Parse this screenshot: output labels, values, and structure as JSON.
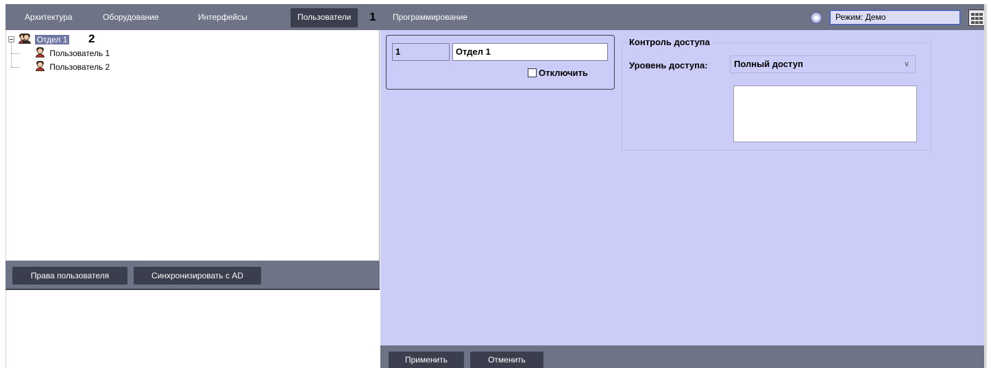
{
  "topbar": {
    "tabs": [
      {
        "label": "Архитектура"
      },
      {
        "label": "Оборудование"
      },
      {
        "label": "Интерфейсы"
      },
      {
        "label": "Пользователи"
      },
      {
        "label": "Программирование"
      }
    ],
    "active_tab": "Пользователи",
    "marker_1": "1",
    "mode_label": "Режим: Демо",
    "colors": {
      "bar": "#6e7386",
      "active": "#3a3e4d"
    }
  },
  "tree": {
    "root": {
      "label": "Отдел 1",
      "icon": "department-icon",
      "expanded": true,
      "selected": true
    },
    "children": [
      {
        "label": "Пользователь 1",
        "icon": "user-icon"
      },
      {
        "label": "Пользователь 2",
        "icon": "user-icon"
      }
    ],
    "marker_2": "2"
  },
  "left_buttons": {
    "rights_label": "Права пользователя",
    "sync_label": "Синхронизировать с AD"
  },
  "form": {
    "id_value": "1",
    "name_value": "Отдел 1",
    "disable_label": "Отключить",
    "disable_checked": false,
    "access_group_title": "Контроль доступа",
    "access_level_label": "Уровень доступа:",
    "access_level_value": "Полный доступ",
    "panel_color": "#ccccf8"
  },
  "footer": {
    "apply_label": "Применить",
    "cancel_label": "Отменить"
  }
}
